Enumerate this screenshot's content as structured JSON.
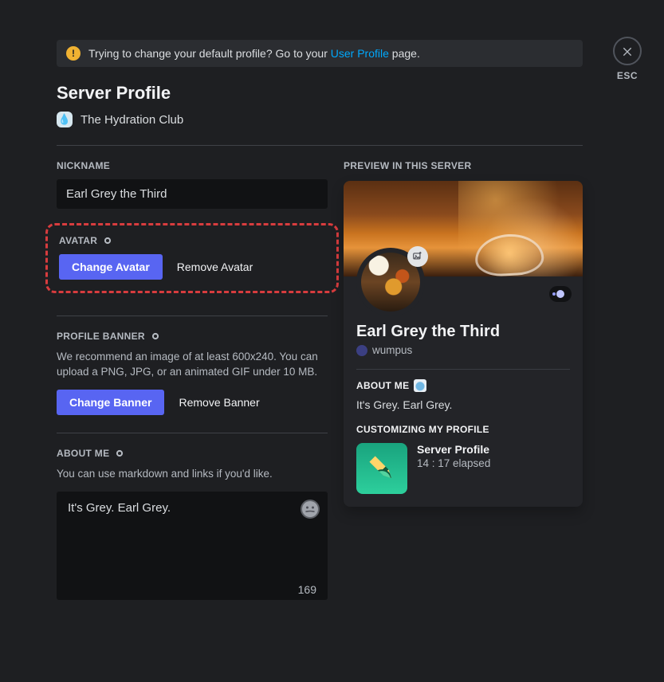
{
  "close": {
    "esc": "ESC"
  },
  "info": {
    "text_pre": "Trying to change your default profile? Go to your ",
    "link": "User Profile",
    "text_post": " page."
  },
  "title": "Server Profile",
  "server": {
    "name": "The Hydration Club"
  },
  "nickname": {
    "label": "NICKNAME",
    "value": "Earl Grey the Third"
  },
  "avatar": {
    "label": "AVATAR",
    "change": "Change Avatar",
    "remove": "Remove Avatar"
  },
  "banner": {
    "label": "PROFILE BANNER",
    "hint": "We recommend an image of at least 600x240. You can upload a PNG, JPG, or an animated GIF under 10 MB.",
    "change": "Change Banner",
    "remove": "Remove Banner"
  },
  "about": {
    "label": "ABOUT ME",
    "hint": "You can use markdown and links if you'd like.",
    "value": "It's Grey. Earl Grey.",
    "remaining": "169"
  },
  "preview": {
    "label": "PREVIEW IN THIS SERVER",
    "display_name": "Earl Grey the Third",
    "handle": "wumpus",
    "about_label": "ABOUT ME",
    "about_value": "It's Grey. Earl Grey.",
    "activity_label": "CUSTOMIZING MY PROFILE",
    "activity_title": "Server Profile",
    "activity_time": "14 : 17 elapsed"
  }
}
